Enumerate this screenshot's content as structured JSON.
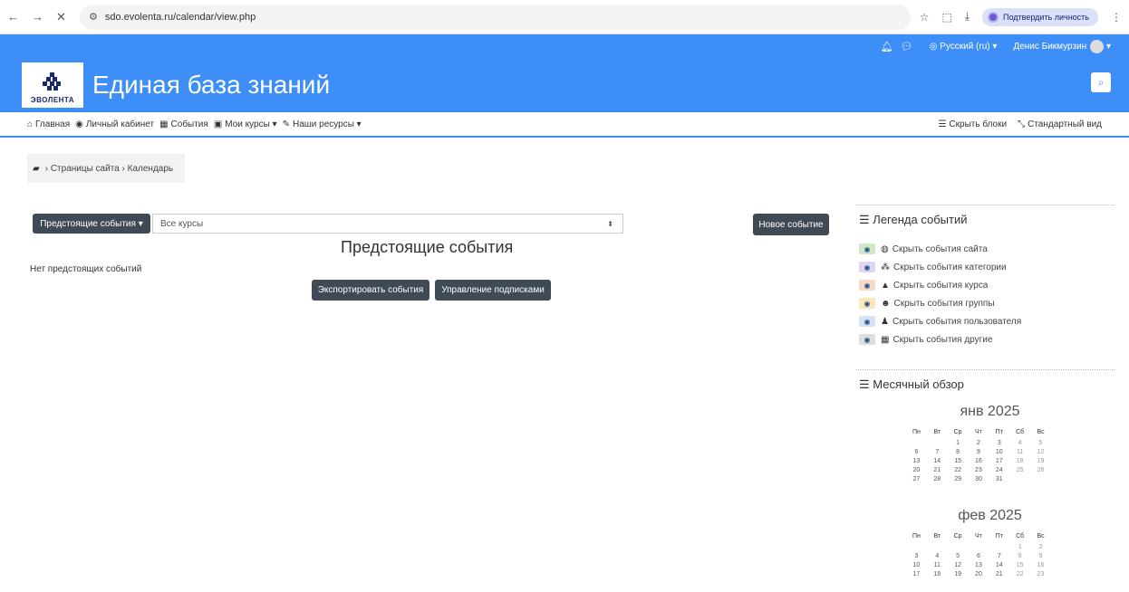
{
  "browser": {
    "url": "sdo.evolenta.ru/calendar/view.php",
    "verify_label": "Подтвердить личность"
  },
  "topnav": {
    "language": "Русский (ru)",
    "user": "Денис Бикмурзин"
  },
  "header": {
    "brand": "ЭВОЛЕНТА",
    "title": "Единая база знаний"
  },
  "menu": {
    "items": [
      {
        "label": "Главная",
        "icon": "home-icon"
      },
      {
        "label": "Личный кабинет",
        "icon": "dashboard-icon"
      },
      {
        "label": "События",
        "icon": "calendar-icon"
      },
      {
        "label": "Мои курсы",
        "icon": "briefcase-icon",
        "dropdown": true
      },
      {
        "label": "Наши ресурсы",
        "icon": "wrench-icon",
        "dropdown": true
      }
    ],
    "right": [
      {
        "label": "Скрыть блоки",
        "icon": "blocks-icon"
      },
      {
        "label": "Стандартный вид",
        "icon": "compress-icon"
      }
    ]
  },
  "breadcrumb": {
    "items": [
      "Страницы сайта",
      "Календарь"
    ]
  },
  "main": {
    "view_button": "Предстоящие события",
    "course_select": "Все курсы",
    "new_event_button": "Новое событие",
    "heading": "Предстоящие события",
    "no_events": "Нет предстоящих событий",
    "export_button": "Экспортировать события",
    "subscriptions_button": "Управление подписками"
  },
  "legend": {
    "title": "Легенда событий",
    "items": [
      {
        "label": "Скрыть события сайта",
        "color": "#cfe9c8"
      },
      {
        "label": "Скрыть события категории",
        "color": "#e3d4f2"
      },
      {
        "label": "Скрыть события курса",
        "color": "#f9d9c9"
      },
      {
        "label": "Скрыть события группы",
        "color": "#fbe8b6"
      },
      {
        "label": "Скрыть события пользователя",
        "color": "#d4e4f4"
      },
      {
        "label": "Скрыть события другие",
        "color": "#dedede"
      }
    ]
  },
  "monthly": {
    "title": "Месячный обзор",
    "weekdays": [
      "Пн",
      "Вт",
      "Ср",
      "Чт",
      "Пт",
      "Сб",
      "Вс"
    ],
    "months": [
      {
        "name": "янв 2025",
        "weeks": [
          [
            "",
            "",
            "1",
            "2",
            "3",
            "4",
            "5"
          ],
          [
            "6",
            "7",
            "8",
            "9",
            "10",
            "11",
            "12"
          ],
          [
            "13",
            "14",
            "15",
            "16",
            "17",
            "18",
            "19"
          ],
          [
            "20",
            "21",
            "22",
            "23",
            "24",
            "25",
            "26"
          ],
          [
            "27",
            "28",
            "29",
            "30",
            "31",
            "",
            ""
          ]
        ]
      },
      {
        "name": "фев 2025",
        "weeks": [
          [
            "",
            "",
            "",
            "",
            "",
            "1",
            "2"
          ],
          [
            "3",
            "4",
            "5",
            "6",
            "7",
            "8",
            "9"
          ],
          [
            "10",
            "11",
            "12",
            "13",
            "14",
            "15",
            "16"
          ],
          [
            "17",
            "18",
            "19",
            "20",
            "21",
            "22",
            "23"
          ]
        ]
      }
    ]
  }
}
